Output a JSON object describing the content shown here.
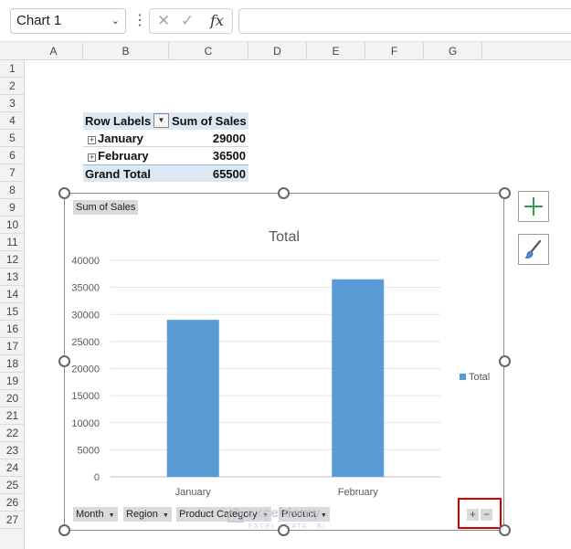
{
  "formula_bar": {
    "name_box": "Chart 1",
    "cancel_icon": "✕",
    "enter_icon": "✓",
    "function_icon": "fx",
    "formula": ""
  },
  "columns": [
    "A",
    "B",
    "C",
    "D",
    "E",
    "F",
    "G"
  ],
  "rows": [
    "1",
    "2",
    "3",
    "4",
    "5",
    "6",
    "7",
    "8",
    "9",
    "10",
    "11",
    "12",
    "13",
    "14",
    "15",
    "16",
    "17",
    "18",
    "19",
    "20",
    "21",
    "22",
    "23",
    "24",
    "25",
    "26",
    "27"
  ],
  "pivot_table": {
    "header": {
      "row_labels": "Row Labels",
      "value": "Sum of Sales"
    },
    "rows": [
      {
        "label": "January",
        "value": "29000"
      },
      {
        "label": "February",
        "value": "36500"
      }
    ],
    "grand_total": {
      "label": "Grand Total",
      "value": "65500"
    }
  },
  "chart": {
    "value_field_button": "Sum of Sales",
    "field_buttons": [
      "Month",
      "Region",
      "Product Category",
      "Product"
    ],
    "zoom_buttons": {
      "plus": "+",
      "minus": "−"
    }
  },
  "chart_data": {
    "type": "bar",
    "title": "Total",
    "categories": [
      "January",
      "February"
    ],
    "series": [
      {
        "name": "Total",
        "values": [
          29000,
          36500
        ],
        "color": "#5b9bd5"
      }
    ],
    "ylim": [
      0,
      40000
    ],
    "yticks": [
      0,
      5000,
      10000,
      15000,
      20000,
      25000,
      30000,
      35000,
      40000
    ],
    "grid": true,
    "legend": "right"
  },
  "watermark": {
    "title": "exceldemy",
    "subtitle": "EXCEL · DATA · BI"
  },
  "colors": {
    "accent": "#5b9bd5",
    "pivot_header": "#dde8f5",
    "highlight": "#d40000"
  }
}
